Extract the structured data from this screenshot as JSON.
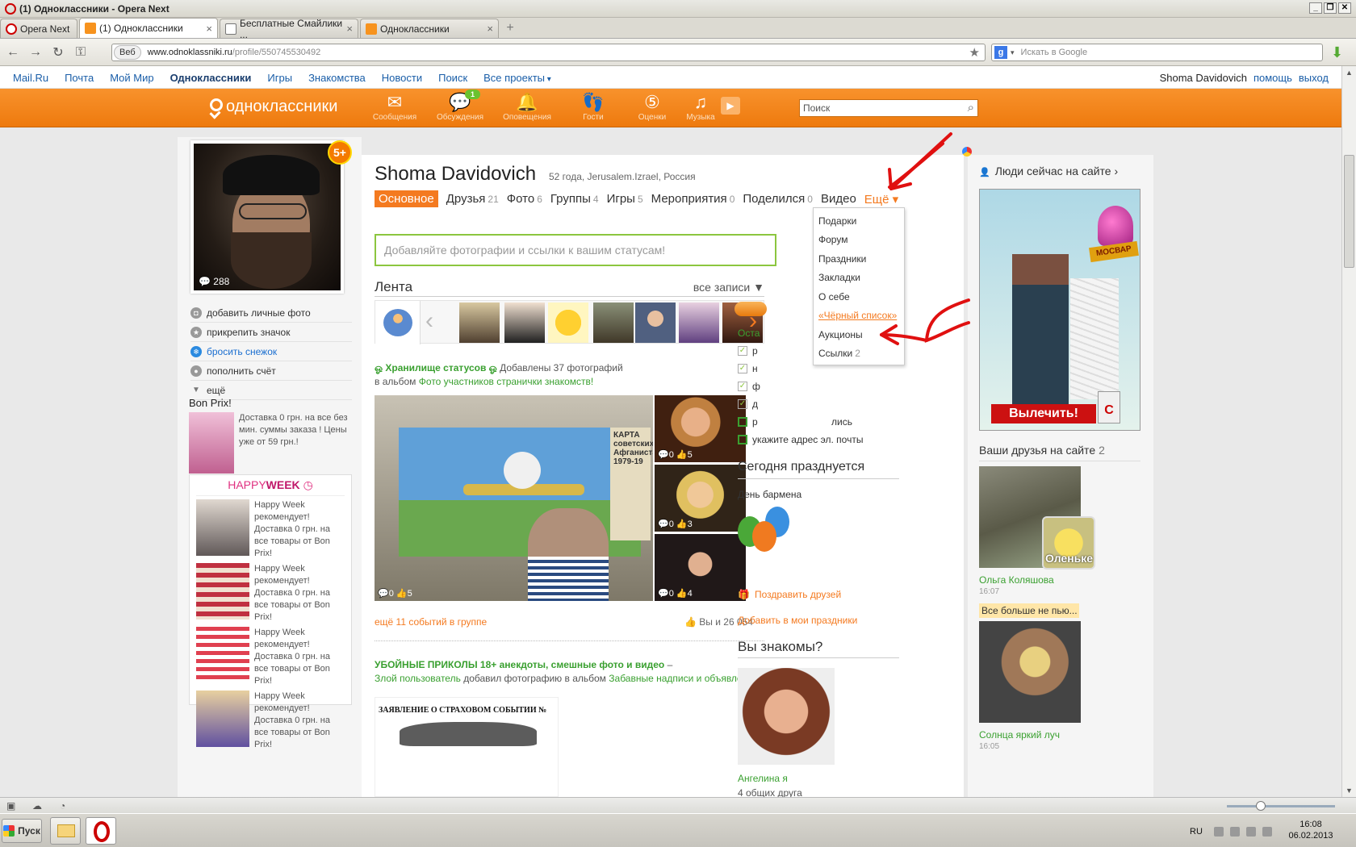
{
  "window": {
    "title": "(1) Одноклассники - Opera Next",
    "buttons": [
      "_",
      "❐",
      "✕"
    ]
  },
  "tabs": [
    {
      "label": "Opera Next",
      "type": "opera"
    },
    {
      "label": "(1) Одноклассники",
      "active": true,
      "close": "×"
    },
    {
      "label": "Бесплатные Смайлики ...",
      "close": "×"
    },
    {
      "label": "Одноклассники",
      "close": "×"
    }
  ],
  "tab_plus": "+",
  "nav": {
    "back": "←",
    "forward": "→",
    "reload": "↻",
    "key": "⚿"
  },
  "address": {
    "badge": "Веб",
    "host": "www.odnoklassniki.ru",
    "path": "/profile/550745530492",
    "star": "★"
  },
  "search_engine": {
    "placeholder": "Искать в Google",
    "logo": "g",
    "dd": "▾"
  },
  "mailbar": {
    "links": [
      "Mail.Ru",
      "Почта",
      "Мой Мир",
      "Одноклассники",
      "Игры",
      "Знакомства",
      "Новости",
      "Поиск",
      "Все проекты"
    ],
    "user": "Shoma Davidovich",
    "help": "помощь",
    "logout": "выход"
  },
  "ok_header": {
    "logo": "одноклассники",
    "nav": [
      {
        "label": "Сообщения",
        "icon": "envelope-icon",
        "glyph": "✉"
      },
      {
        "label": "Обсуждения",
        "icon": "discussions-icon",
        "glyph": "💬",
        "badge": "1"
      },
      {
        "label": "Оповещения",
        "icon": "bell-icon",
        "glyph": "🔔"
      },
      {
        "label": "Гости",
        "icon": "footprints-icon",
        "glyph": "👣"
      },
      {
        "label": "Оценки",
        "icon": "ratings-icon",
        "glyph": "⑤"
      },
      {
        "label": "Музыка",
        "icon": "music-icon",
        "glyph": "♫"
      }
    ],
    "play": "▶",
    "search_placeholder": "Поиск",
    "search_icon": "⌕"
  },
  "profile": {
    "name": "Shoma Davidovich",
    "info": "52 года, Jerusalem.Izrael, Россия",
    "photo_comments": "288",
    "rating_badge": "5+",
    "tabs": [
      {
        "label": "Основное",
        "count": "",
        "active": true
      },
      {
        "label": "Друзья",
        "count": "21"
      },
      {
        "label": "Фото",
        "count": "6"
      },
      {
        "label": "Группы",
        "count": "4"
      },
      {
        "label": "Игры",
        "count": "5"
      },
      {
        "label": "Мероприятия",
        "count": "0"
      },
      {
        "label": "Поделился",
        "count": "0"
      },
      {
        "label": "Видео",
        "count": ""
      },
      {
        "label": "Ещё ▾",
        "count": "",
        "more": true
      }
    ]
  },
  "left_menu": [
    {
      "label": "добавить личные фото",
      "icon": "camera-icon",
      "glyph": "◘"
    },
    {
      "label": "прикрепить значок",
      "icon": "badge-icon",
      "glyph": "★"
    },
    {
      "label": "бросить снежок",
      "icon": "snowball-icon",
      "glyph": "❄",
      "blue": true
    },
    {
      "label": "пополнить счёт",
      "icon": "coin-icon",
      "glyph": "●"
    },
    {
      "label": "ещё",
      "icon": "triangle-down-icon",
      "glyph": "▼",
      "more": true
    }
  ],
  "bonprix": {
    "title": "Bon Prix!",
    "text": "Доставка 0 грн. на все без мин. суммы заказа ! Цены уже от 59 грн.!"
  },
  "happyweek": {
    "title_a": "HAPPY",
    "title_b": "WEEK",
    "items": [
      "Happy Week рекомендует! Доставка 0 грн. на все товары от Bon Prix!",
      "Happy Week рекомендует! Доставка 0 грн. на все товары от Bon Prix!",
      "Happy Week рекомендует! Доставка 0 грн. на все товары от Bon Prix!",
      "Happy Week рекомендует! Доставка 0 грн. на все товары от Bon Prix!"
    ]
  },
  "status_prompt": "Добавляйте фотографии и ссылки к вашим статусам!",
  "feed": {
    "title": "Лента",
    "filter": "все записи ▼",
    "arrow_left": "‹",
    "arrow_right": "›",
    "post1": {
      "group": "ஓ Хранилище статусов ஓ",
      "action": "Добавлены 37 фотографий",
      "in_album": "в альбом",
      "album": "Фото участников странички знакомств!"
    },
    "main_photo": {
      "comments": "0",
      "likes": "5",
      "map_text": "КАРТА советских Афганистан 1979-19"
    },
    "side_photos": [
      {
        "comments": "0",
        "likes": "5"
      },
      {
        "comments": "0",
        "likes": "3"
      },
      {
        "comments": "0",
        "likes": "4"
      }
    ],
    "more_events": "ещё 11 событий в группе",
    "likes_text": "Вы и 26 054",
    "post2": {
      "group": "УБОЙНЫЕ ПРИКОЛЫ 18+ анекдоты, смешные фото и видео",
      "dash": " –",
      "user": "Злой пользователь",
      "action": "добавил фотографию в альбом",
      "album": "Забавные надписи и объявления."
    },
    "doc_title": "ЗАЯВЛЕНИЕ О СТРАХОВОМ СОБЫТИИ №"
  },
  "dropdown": [
    {
      "label": "Подарки"
    },
    {
      "label": "Форум"
    },
    {
      "label": "Праздники"
    },
    {
      "label": "Закладки"
    },
    {
      "label": "О себе"
    },
    {
      "label": "«Чёрный список»",
      "blacklist": true
    },
    {
      "label": "Аукционы"
    },
    {
      "label": "Ссылки",
      "count": "2"
    }
  ],
  "todo": {
    "header": "Оста",
    "header_tail": "...",
    "items": [
      {
        "label": "р",
        "tail": "а",
        "done": true
      },
      {
        "label": "н",
        "tail": "",
        "done": true
      },
      {
        "label": "ф",
        "tail": "",
        "done": true
      },
      {
        "label": "д",
        "tail": "",
        "done": true
      },
      {
        "label": "р",
        "tail": "лись",
        "done": false
      },
      {
        "label": "укажите адрес эл. почты",
        "tail": "",
        "done": false
      }
    ],
    "check": "✓"
  },
  "holiday": {
    "title": "Сегодня празднуется",
    "name": "День бармена",
    "congratulate": "Поздравить друзей",
    "add": "Добавить в мои праздники"
  },
  "know": {
    "title": "Вы знакомы?",
    "name": "Ангелина я",
    "common": "4 общих друга"
  },
  "right": {
    "online_title": "Люди сейчас на сайте ›",
    "ad": {
      "sign": "МОСВАР",
      "cta": "Вылечить!",
      "bottle": "C"
    },
    "friends_online": "Ваши друзья на сайте",
    "friends_online_count": "2",
    "friend1": {
      "name": "Ольга Коляшова",
      "time": "16:07",
      "gift_text": "Оленьке"
    },
    "friend2": {
      "status": "Все больше не пью...",
      "name": "Солнца яркий луч",
      "time": "16:05"
    }
  },
  "taskbar": {
    "start": "Пуск",
    "lang": "RU",
    "time": "16:08",
    "date": "06.02.2013"
  },
  "colors": {
    "ok_orange": "#f47a20",
    "ok_green": "#3aa030",
    "link_blue": "#1a5ea8",
    "arrow_red": "#e01010"
  }
}
